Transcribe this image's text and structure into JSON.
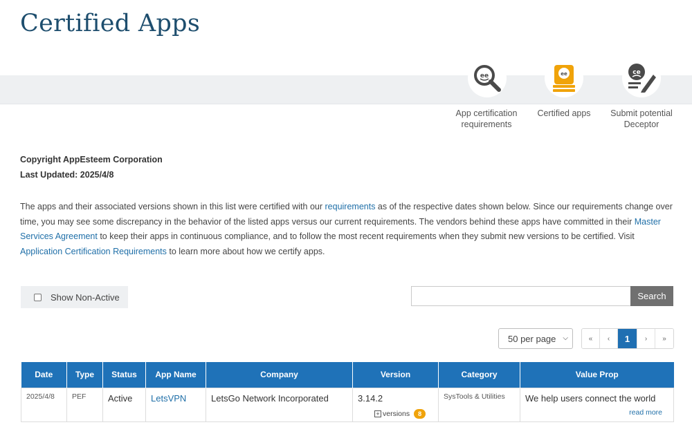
{
  "page": {
    "title": "Certified Apps"
  },
  "nav": [
    {
      "label": "App certification requirements",
      "icon": "magnifier-face-icon"
    },
    {
      "label": "Certified apps",
      "icon": "certified-badge-icon"
    },
    {
      "label": "Submit potential Deceptor",
      "icon": "report-pencil-icon"
    }
  ],
  "meta": {
    "copyright": "Copyright AppEsteem Corporation",
    "updated": "Last Updated: 2025/4/8"
  },
  "intro": {
    "p1": "The apps and their associated versions shown in this list were certified with our ",
    "link1": "requirements",
    "p2": " as of the respective dates shown below. Since our requirements change over time, you may see some discrepancy in the behavior of the listed apps versus our current requirements. The vendors behind these apps have committed in their ",
    "link2": "Master Services Agreement",
    "p3": " to keep their apps in continuous compliance, and to follow the most recent requirements when they submit new versions to be certified. Visit ",
    "link3": "Application Certification Requirements",
    "p4": " to learn more about how we certify apps."
  },
  "filters": {
    "show_non_active": "Show Non-Active",
    "show_non_active_checked": false,
    "search_value": "",
    "search_button": "Search",
    "per_page": "50 per page"
  },
  "pager": {
    "first": "«",
    "prev": "‹",
    "current": "1",
    "next": "›",
    "last": "»"
  },
  "table": {
    "columns": [
      "Date",
      "Type",
      "Status",
      "App Name",
      "Company",
      "Version",
      "Category",
      "Value Prop"
    ],
    "rows": [
      {
        "date": "2025/4/8",
        "type": "PEF",
        "status": "Active",
        "app_name": "LetsVPN",
        "company": "LetsGo Network Incorporated",
        "version": "3.14.2",
        "versions_label": "versions",
        "versions_count": "8",
        "category": "SysTools & Utilities",
        "value_prop": "We help users connect the world",
        "read_more": "read more"
      }
    ]
  },
  "colors": {
    "title": "#1e4e6e",
    "header": "#1f72b8",
    "link": "#1f6fa8",
    "badge": "#f0a30a",
    "accent": "#f0a30a"
  }
}
